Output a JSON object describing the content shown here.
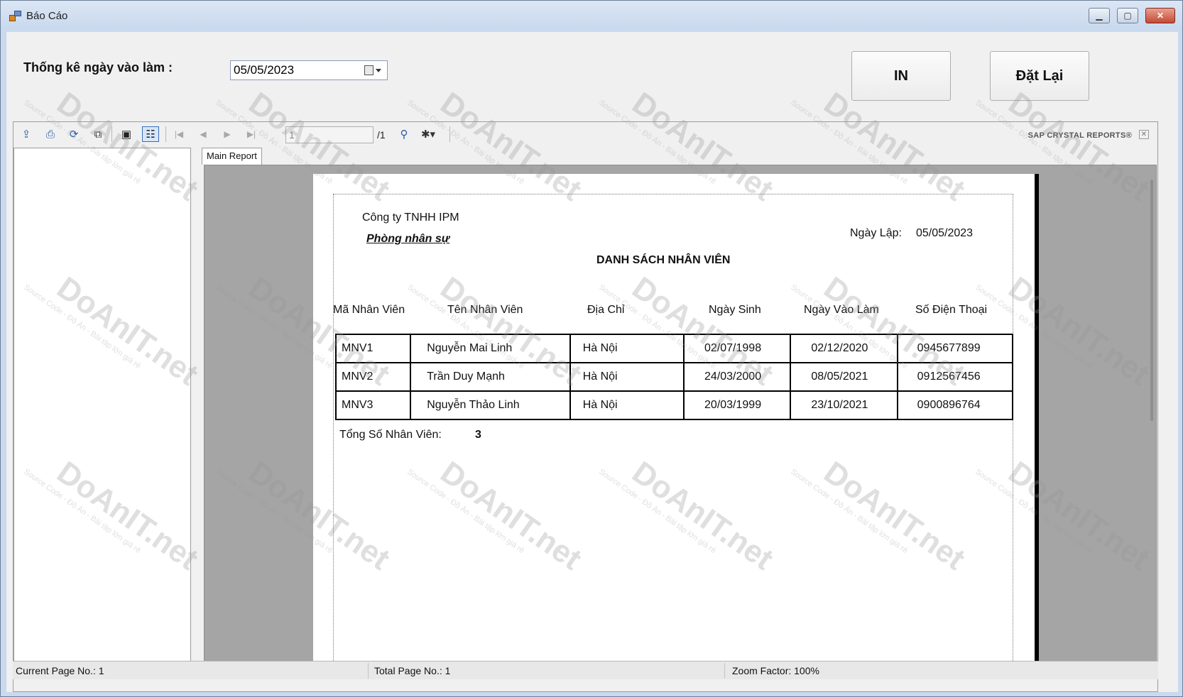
{
  "window": {
    "title": "Báo Cáo"
  },
  "filter": {
    "label": "Thống kê ngày vào làm :",
    "date_value": "05/05/2023"
  },
  "buttons": {
    "print_label": "IN",
    "reset_label": "Đặt Lại"
  },
  "viewer": {
    "page_input": "1",
    "page_total": "/1",
    "brand": "SAP CRYSTAL REPORTS®",
    "tab_label": "Main Report"
  },
  "report": {
    "company": "Công ty TNHH IPM",
    "department": "Phòng nhân sự",
    "created_label": "Ngày Lập:",
    "created_value": "05/05/2023",
    "title": "DANH SÁCH NHÂN VIÊN",
    "columns": [
      "Mã Nhân Viên",
      "Tên Nhân Viên",
      "Địa Chỉ",
      "Ngày Sinh",
      "Ngày Vào Làm",
      "Số Điện Thoại"
    ],
    "rows": [
      [
        "MNV1",
        "Nguyễn Mai Linh",
        "Hà Nội",
        "02/07/1998",
        "02/12/2020",
        "0945677899"
      ],
      [
        "MNV2",
        "Trần Duy Mạnh",
        "Hà Nội",
        "24/03/2000",
        "08/05/2021",
        "0912567456"
      ],
      [
        "MNV3",
        "Nguyễn Thảo Linh",
        "Hà Nội",
        "20/03/1999",
        "23/10/2021",
        "0900896764"
      ]
    ],
    "total_label": "Tổng Số Nhân Viên:",
    "total_value": "3"
  },
  "status": {
    "current_page": "Current Page No.: 1",
    "total_page": "Total Page No.: 1",
    "zoom": "Zoom Factor: 100%"
  },
  "watermark": {
    "text": "DoAnIT.net",
    "subtext": "Source Code - Đồ Án - Bài tập lớn giá rẻ"
  }
}
